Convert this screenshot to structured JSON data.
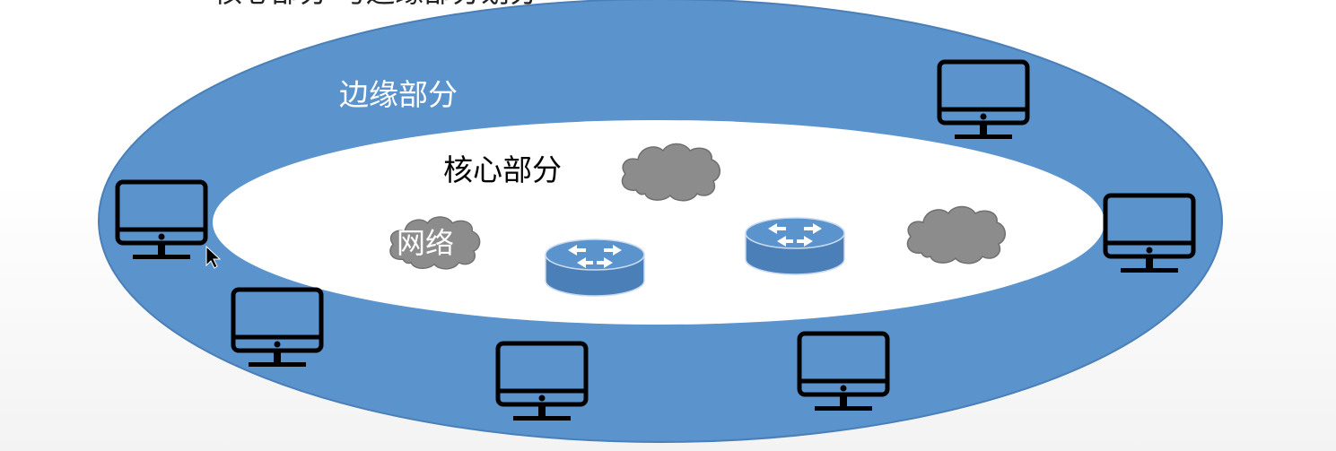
{
  "slide": {
    "heading": "核心部分  与边缘部分划分"
  },
  "diagram": {
    "edge_label": "边缘部分",
    "core_label": "核心部分",
    "network_label": "网络",
    "colors": {
      "edge_ring": "#5b93cd",
      "edge_ring_stroke": "#4a7fb8",
      "core_area": "#ffffff",
      "cloud": "#8c8c8c",
      "router_top": "#5b93cd",
      "router_side": "#4a7fb8",
      "monitor": "#000000"
    },
    "icons": {
      "host": "desktop-monitor-icon",
      "router": "router-icon",
      "network": "cloud-icon",
      "cursor": "mouse-pointer-icon"
    }
  }
}
